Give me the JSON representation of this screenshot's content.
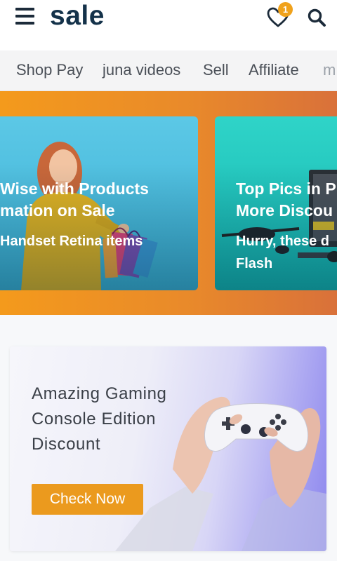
{
  "header": {
    "logo": "sale",
    "wishlist_count": "1"
  },
  "nav": {
    "items": [
      "Shop Pay",
      "juna videos",
      "Sell",
      "Affiliate",
      "m"
    ]
  },
  "promos": [
    {
      "title_line1": " Wise with Products",
      "title_line2": "mation on Sale",
      "subtitle": "Handset Retina items"
    },
    {
      "title_line1": "Top Pics in P",
      "title_line2": "More Discou",
      "subtitle_line1": "Hurry, these d",
      "subtitle_line2": "Flash"
    }
  ],
  "gaming_banner": {
    "title_line1": "Amazing Gaming",
    "title_line2": "Console Edition",
    "title_line3": "Discount",
    "cta_label": "Check Now"
  },
  "colors": {
    "brand": "#14324a",
    "accent": "#f0a21c",
    "band": "#f49a1c"
  }
}
